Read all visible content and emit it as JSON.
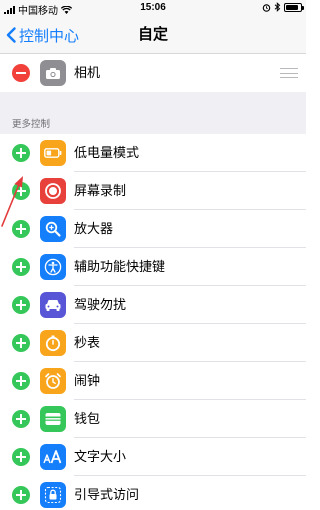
{
  "status_bar": {
    "carrier": "中国移动",
    "time": "15:06",
    "battery_level": 0.85
  },
  "nav": {
    "back_label": "控制中心",
    "title": "自定"
  },
  "included": [
    {
      "label": "相机",
      "icon": "camera-icon",
      "color": "#8e8e93"
    }
  ],
  "more_controls": {
    "header": "更多控制",
    "items": [
      {
        "label": "低电量模式",
        "icon": "low-power-icon",
        "color": "#f8a51b"
      },
      {
        "label": "屏幕录制",
        "icon": "screen-record-icon",
        "color": "#e8403a"
      },
      {
        "label": "放大器",
        "icon": "magnifier-icon",
        "color": "#147efb"
      },
      {
        "label": "辅助功能快捷键",
        "icon": "accessibility-icon",
        "color": "#147efb"
      },
      {
        "label": "驾驶勿扰",
        "icon": "car-icon",
        "color": "#5856d6"
      },
      {
        "label": "秒表",
        "icon": "stopwatch-icon",
        "color": "#f8a51b"
      },
      {
        "label": "闹钟",
        "icon": "alarm-clock-icon",
        "color": "#f8a51b"
      },
      {
        "label": "钱包",
        "icon": "wallet-icon",
        "color": "#35c759"
      },
      {
        "label": "文字大小",
        "icon": "text-size-icon",
        "color": "#147efb"
      },
      {
        "label": "引导式访问",
        "icon": "guided-access-lock-icon",
        "color": "#147efb"
      }
    ]
  }
}
